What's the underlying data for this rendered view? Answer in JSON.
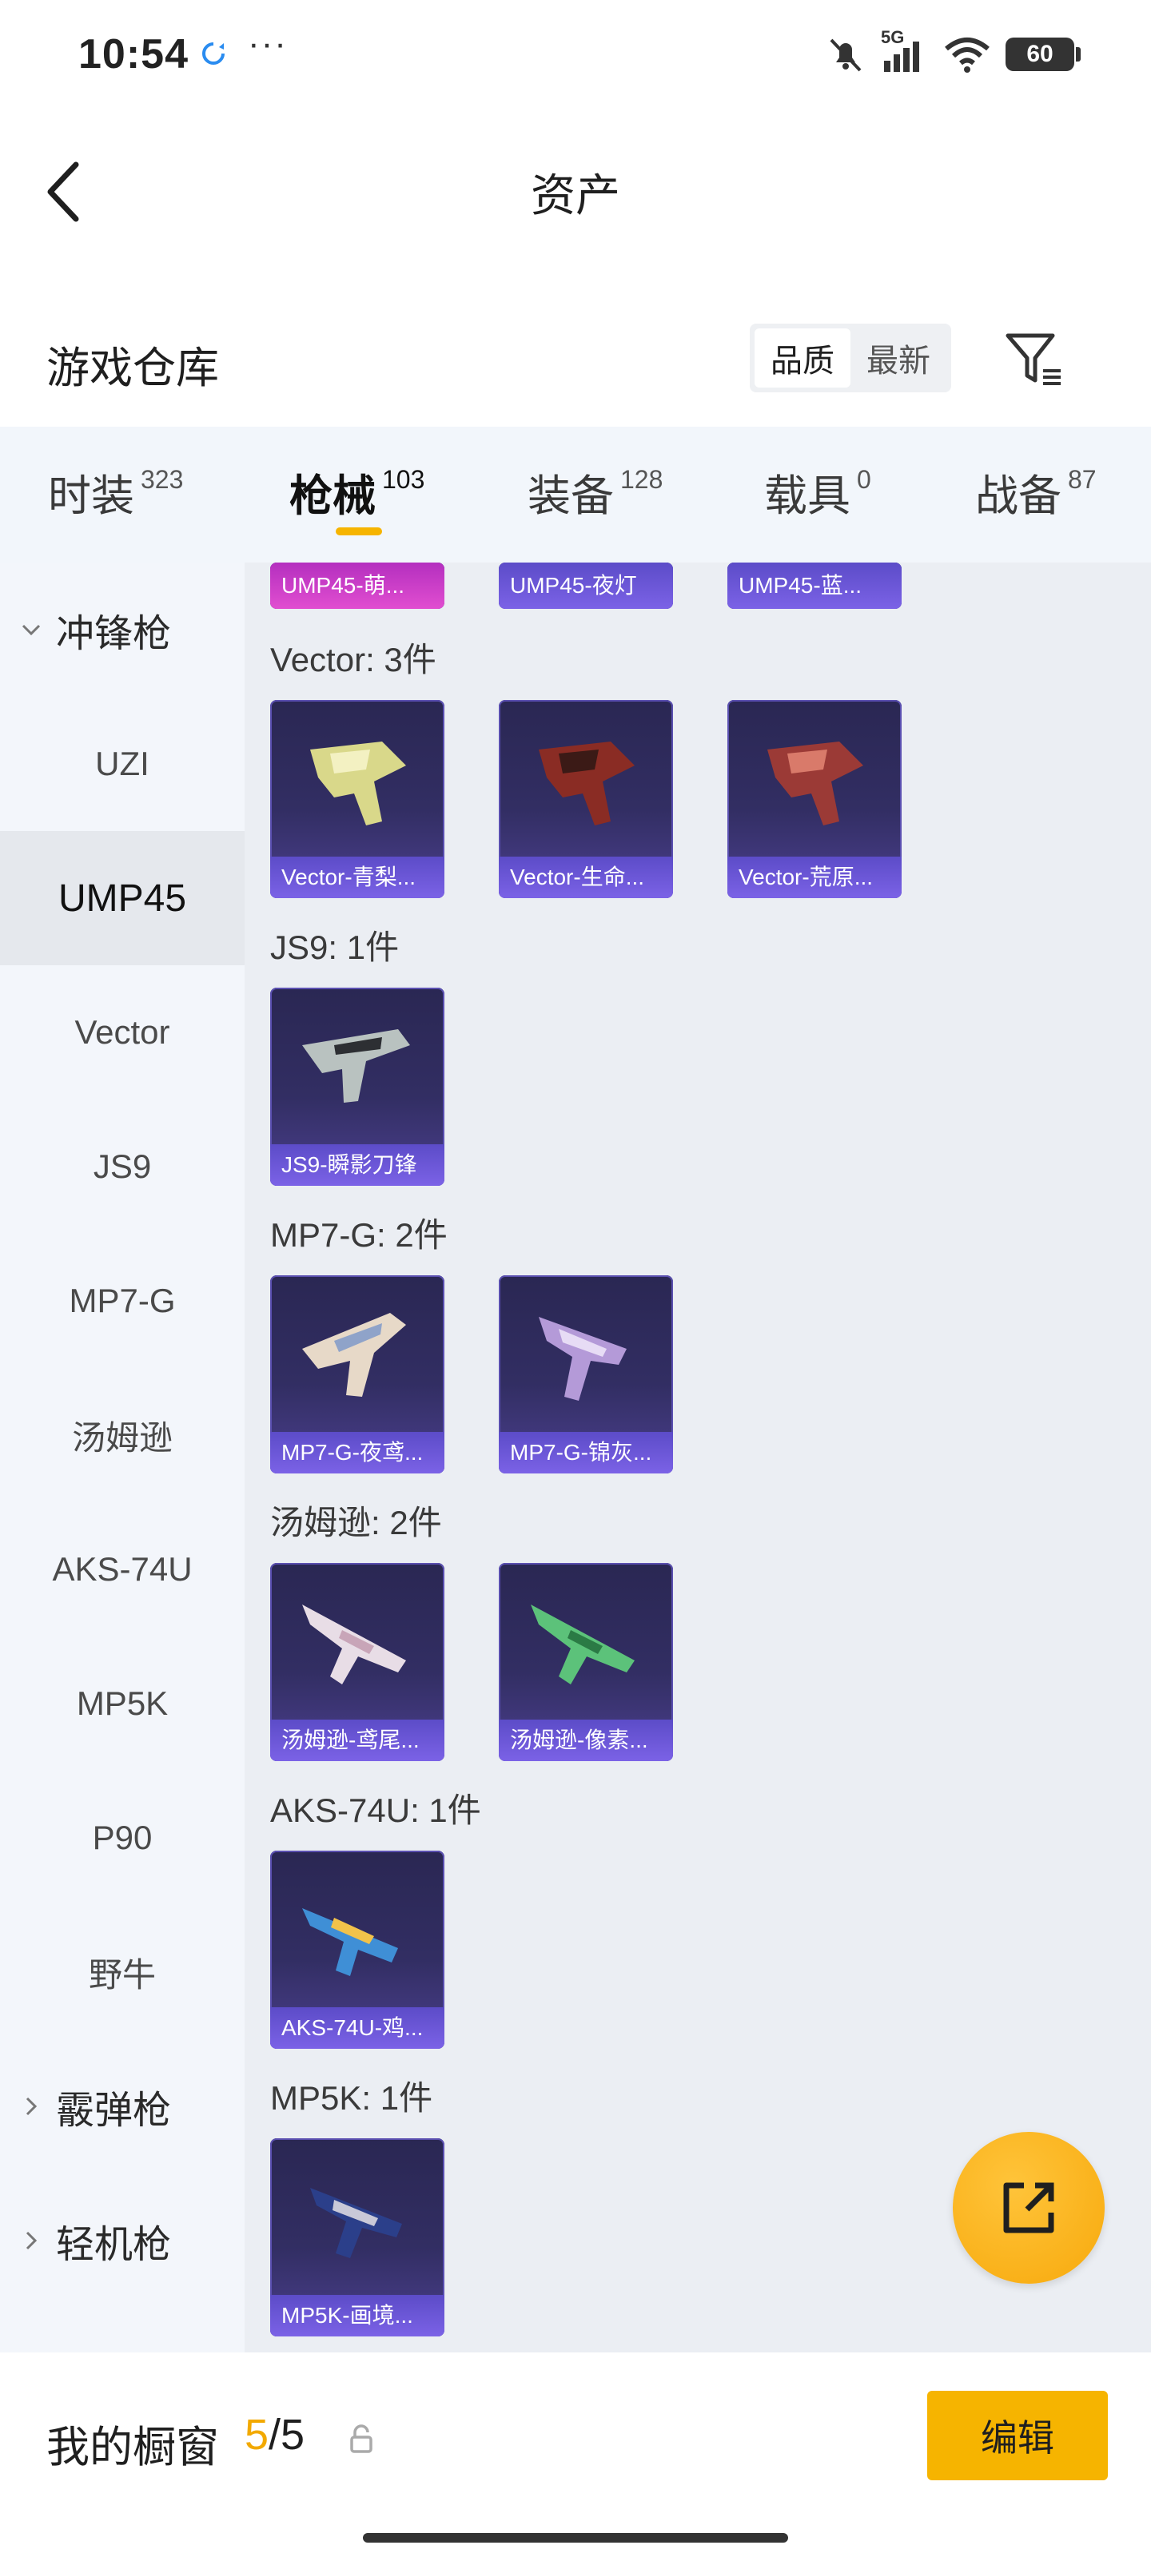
{
  "status_bar": {
    "time": "10:54",
    "more": "···",
    "network": "5G",
    "battery": "60"
  },
  "header": {
    "title": "资产"
  },
  "warehouse": {
    "title": "游戏仓库",
    "sort_options": [
      "品质",
      "最新"
    ],
    "active_sort": "品质"
  },
  "tabs": [
    {
      "label": "时装",
      "count": "323"
    },
    {
      "label": "枪械",
      "count": "103",
      "active": true
    },
    {
      "label": "装备",
      "count": "128"
    },
    {
      "label": "载具",
      "count": "0"
    },
    {
      "label": "战备",
      "count": "87"
    }
  ],
  "sidebar": {
    "groups": [
      {
        "label": "冲锋枪",
        "expanded": true
      },
      {
        "label": "霰弹枪",
        "expanded": false
      },
      {
        "label": "轻机枪",
        "expanded": false
      }
    ],
    "items": [
      "UZI",
      "UMP45",
      "Vector",
      "JS9",
      "MP7-G",
      "汤姆逊",
      "AKS-74U",
      "MP5K",
      "P90",
      "野牛"
    ],
    "active_item": "UMP45"
  },
  "content": {
    "partial_top_cards": [
      "UMP45-萌...",
      "UMP45-夜灯",
      "UMP45-蓝..."
    ],
    "sections": [
      {
        "title": "Vector: 3件",
        "cards": [
          "Vector-青梨...",
          "Vector-生命...",
          "Vector-荒原..."
        ]
      },
      {
        "title": "JS9: 1件",
        "cards": [
          "JS9-瞬影刀锋"
        ]
      },
      {
        "title": "MP7-G: 2件",
        "cards": [
          "MP7-G-夜鸢...",
          "MP7-G-锦灰..."
        ]
      },
      {
        "title": "汤姆逊: 2件",
        "cards": [
          "汤姆逊-鸢尾...",
          "汤姆逊-像素..."
        ]
      },
      {
        "title": "AKS-74U: 1件",
        "cards": [
          "AKS-74U-鸡..."
        ]
      },
      {
        "title": "MP5K: 1件",
        "cards": [
          "MP5K-画境..."
        ]
      }
    ]
  },
  "bottom": {
    "showcase_label": "我的橱窗",
    "showcase_current": "5",
    "showcase_total": "/5",
    "edit_label": "编辑"
  },
  "colors": {
    "accent": "#f6b400",
    "card_bg": "#2a2753",
    "card_caption": "#6b57d8",
    "card_caption_pink": "#d13fc9",
    "sidebar_bg": "#f3f6fb",
    "content_bg": "#ebeef3"
  }
}
